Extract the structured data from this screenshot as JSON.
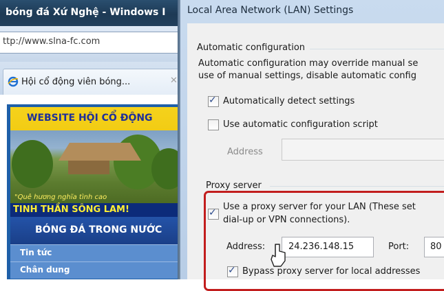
{
  "background_window": {
    "title": "bóng đá Xứ Nghệ - Windows I",
    "address": "ttp://www.slna-fc.com",
    "tab": {
      "label": "Hội cổ động viên bóng...",
      "close": "✕"
    },
    "site": {
      "banner_title": "WEBSITE HỘI CỔ ĐỘNG",
      "slogan": "\"Quê hương nghĩa tình cao",
      "spirit": "TINH THẦN SÔNG LAM!",
      "section_title": "BÓNG ĐÁ TRONG NƯỚC",
      "nav": [
        "Tin tức",
        "Chân dung"
      ]
    }
  },
  "dialog": {
    "title": "Local Area Network (LAN) Settings",
    "auto_config": {
      "group_label": "Automatic configuration",
      "description_line1": "Automatic configuration may override manual se",
      "description_line2": "use of manual settings, disable automatic config",
      "detect": {
        "label": "Automatically detect settings",
        "checked": true
      },
      "script": {
        "label": "Use automatic configuration script",
        "checked": false
      },
      "address_label": "Address",
      "address_value": ""
    },
    "proxy": {
      "group_label": "Proxy server",
      "use_proxy": {
        "label_line1": "Use a proxy server for your LAN (These set",
        "label_line2": "dial-up or VPN connections).",
        "checked": true
      },
      "address_label": "Address:",
      "address_value": "24.236.148.15",
      "port_label": "Port:",
      "port_value": "80",
      "bypass": {
        "label": "Bypass proxy server for local addresses",
        "checked": true
      }
    }
  },
  "colors": {
    "highlight": "#c21d1d",
    "dialog_bg": "#f0f0f0",
    "site_blue": "#1e5fa8"
  }
}
